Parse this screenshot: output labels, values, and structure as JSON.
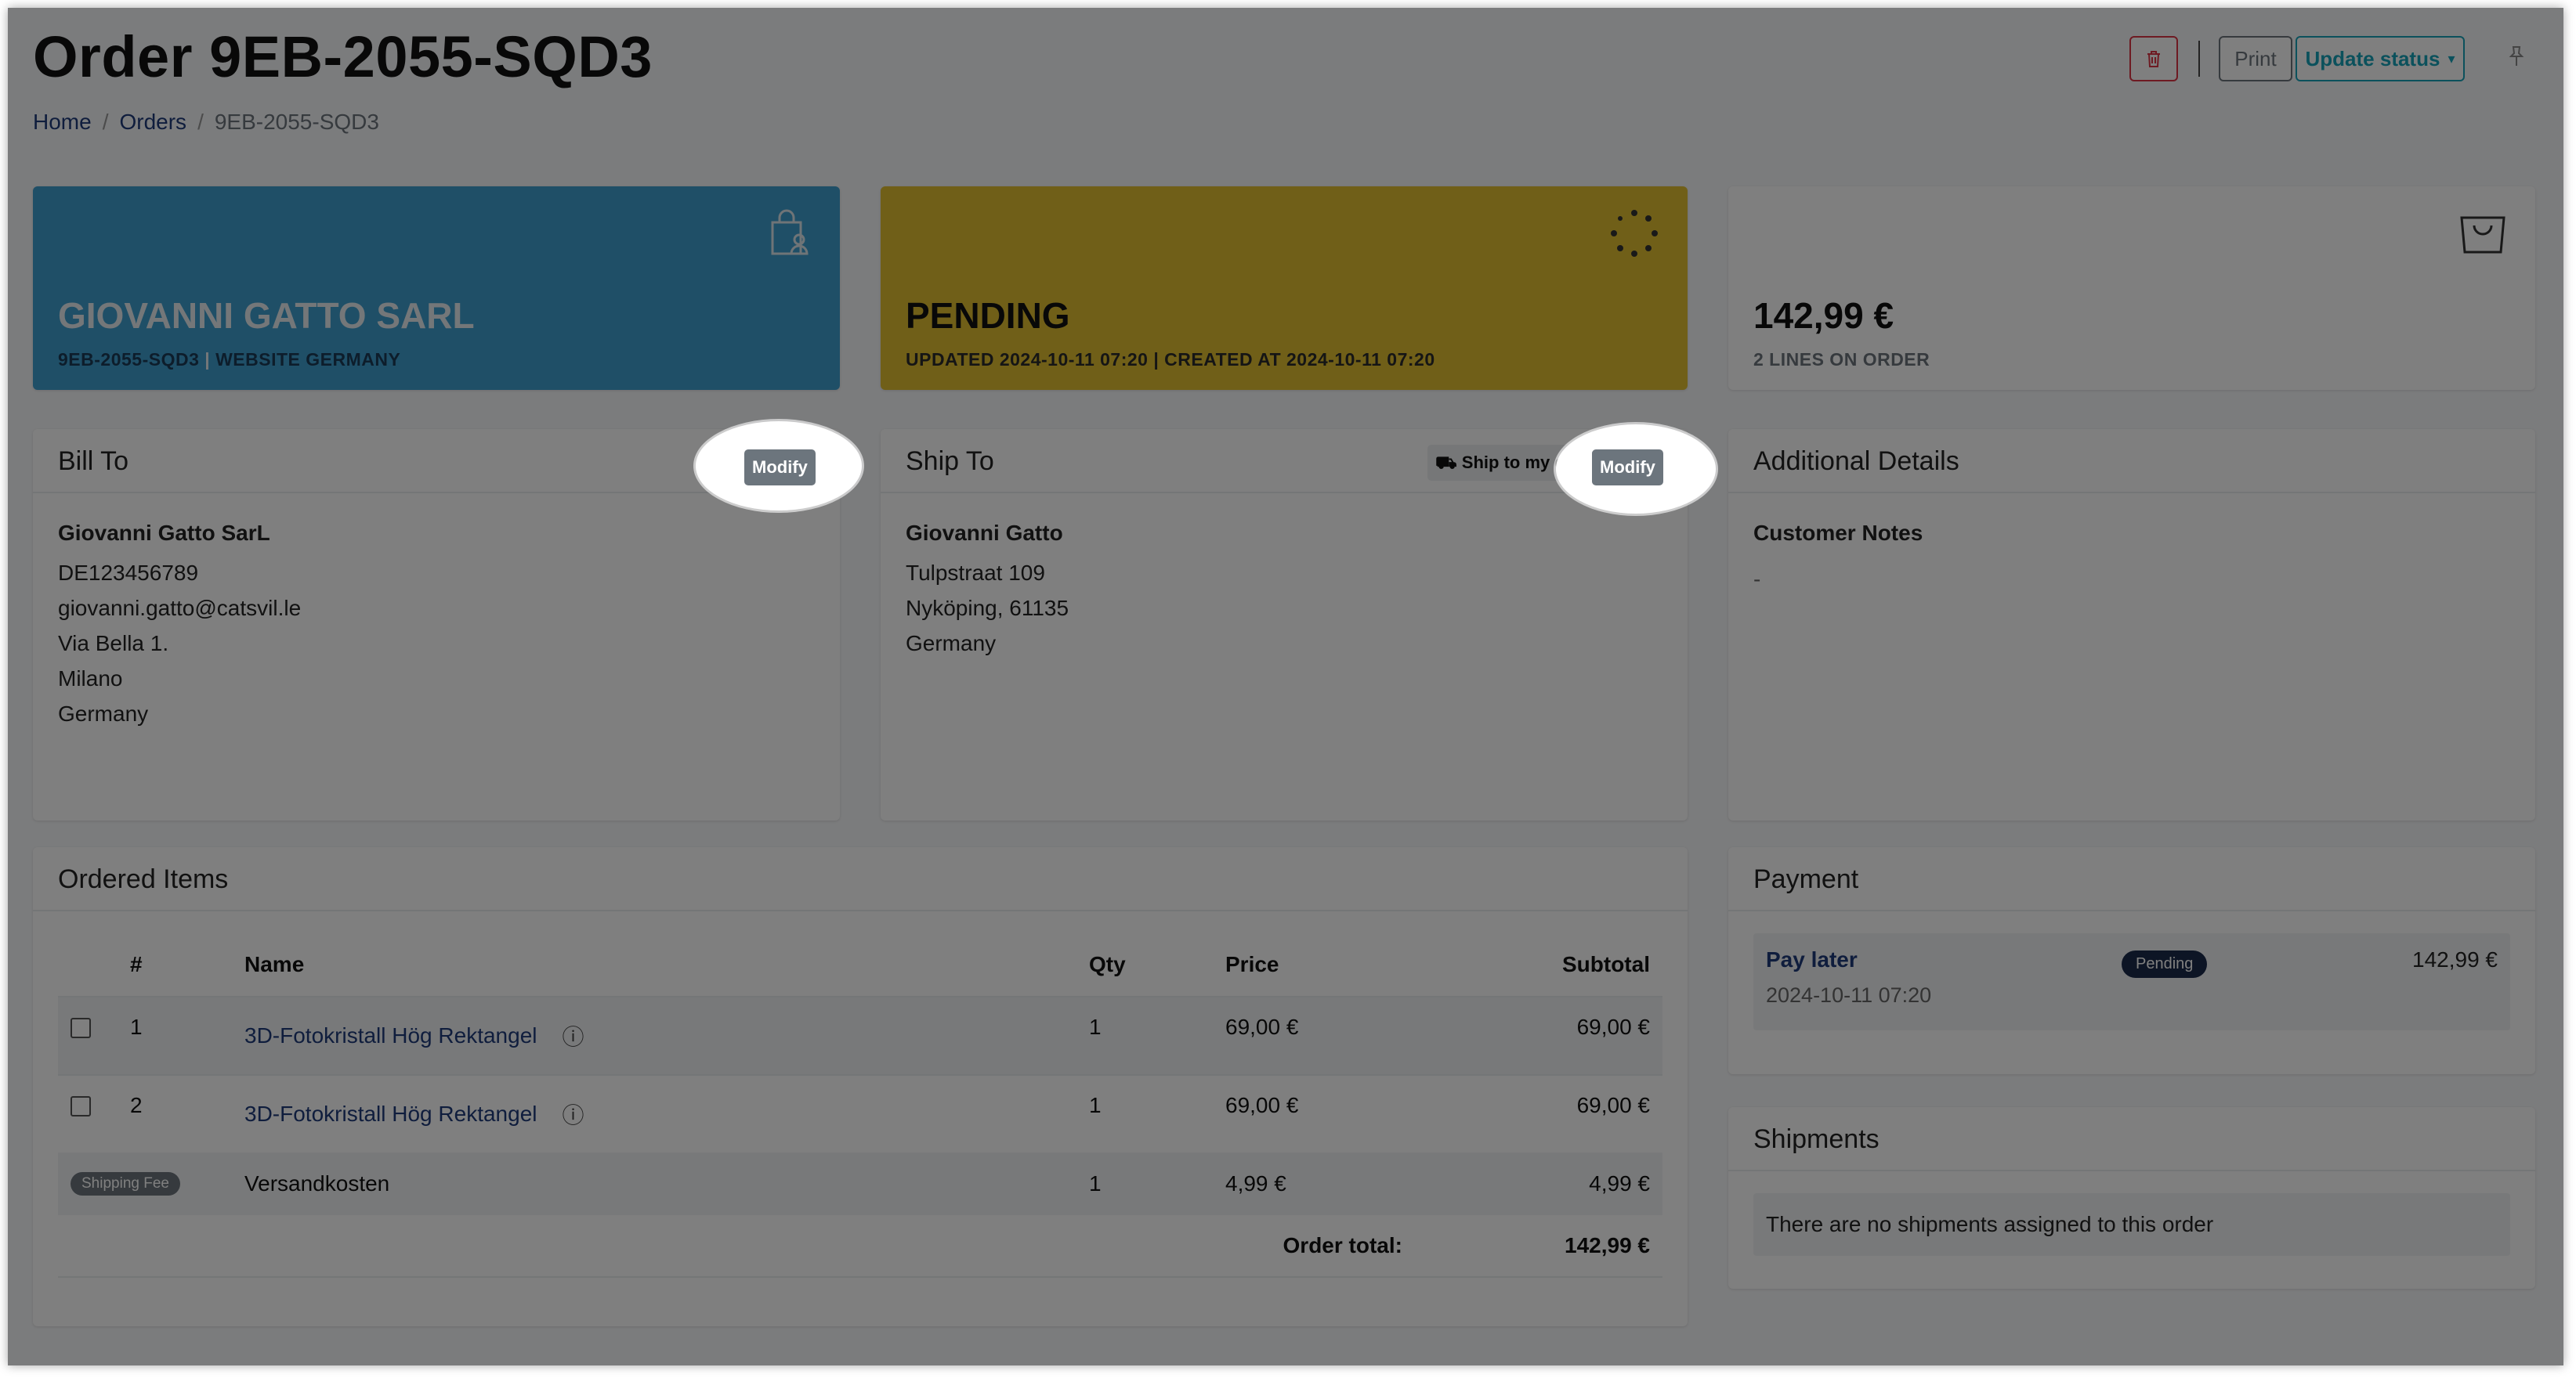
{
  "header": {
    "title": "Order 9EB-2055-SQD3",
    "breadcrumb": [
      "Home",
      "Orders",
      "9EB-2055-SQD3"
    ],
    "print_label": "Print",
    "update_status_label": "Update status"
  },
  "customer_card": {
    "name": "GIOVANNI GATTO SARL",
    "order_id": "9EB-2055-SQD3",
    "separator": " | ",
    "channel": "WEBSITE GERMANY"
  },
  "status_card": {
    "status": "PENDING",
    "meta": "UPDATED 2024-10-11 07:20 | CREATED AT 2024-10-11 07:20"
  },
  "total_card": {
    "amount": "142,99 €",
    "lines": "2 LINES ON ORDER"
  },
  "bill_to": {
    "title": "Bill To",
    "modify_label": "Modify",
    "name": "Giovanni Gatto SarL",
    "lines": [
      "DE123456789",
      "giovanni.gatto@catsvil.le",
      "Via Bella 1.",
      "Milano",
      "Germany"
    ]
  },
  "ship_to": {
    "title": "Ship To",
    "door_label": "Ship to my door",
    "modify_label": "Modify",
    "name": "Giovanni Gatto",
    "lines": [
      "Tulpstraat 109",
      "Nyköping, 61135",
      "Germany"
    ]
  },
  "additional": {
    "title": "Additional Details",
    "notes_title": "Customer Notes",
    "notes_value": "-"
  },
  "ordered_items": {
    "title": "Ordered Items",
    "columns": [
      "#",
      "Name",
      "Qty",
      "Price",
      "Subtotal"
    ],
    "rows": [
      {
        "num": "1",
        "name": "3D-Fotokristall Hög Rektangel",
        "qty": "1",
        "price": "69,00 €",
        "subtotal": "69,00 €"
      },
      {
        "num": "2",
        "name": "3D-Fotokristall Hög Rektangel",
        "qty": "1",
        "price": "69,00 €",
        "subtotal": "69,00 €"
      }
    ],
    "shipping": {
      "badge": "Shipping Fee",
      "name": "Versandkosten",
      "qty": "1",
      "price": "4,99 €",
      "subtotal": "4,99 €"
    },
    "total_label": "Order total:",
    "total_value": "142,99 €"
  },
  "payment": {
    "title": "Payment",
    "method": "Pay later",
    "badge": "Pending",
    "amount": "142,99 €",
    "date": "2024-10-11 07:20"
  },
  "shipments": {
    "title": "Shipments",
    "empty": "There are no shipments assigned to this order"
  },
  "icons": {
    "trash": "trash-icon",
    "pin": "pin-icon",
    "customer": "shopping-bag-person-icon",
    "status": "spinner-icon",
    "total": "shopping-bag-icon",
    "door": "truck-icon",
    "product_info": "info-circle-icon"
  },
  "colors": {
    "customer_card": "#3f9fcf",
    "status_card": "#e0bf30",
    "accent": "#17a2b8",
    "danger": "#dc3545"
  }
}
